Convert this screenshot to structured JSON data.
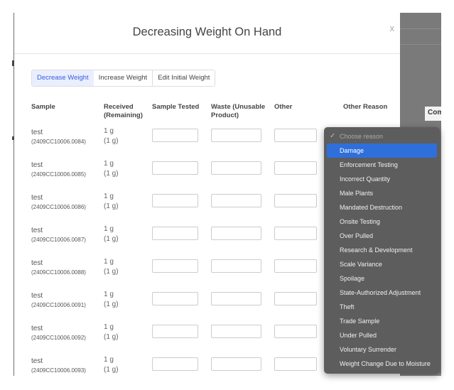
{
  "modal": {
    "title": "Decreasing Weight On Hand",
    "close_label": "x"
  },
  "tabs": [
    {
      "label": "Decrease Weight",
      "active": true
    },
    {
      "label": "Increase Weight",
      "active": false
    },
    {
      "label": "Edit Initial Weight",
      "active": false
    }
  ],
  "columns": {
    "sample": "Sample",
    "received": "Received (Remaining)",
    "sample_tested": "Sample Tested",
    "waste": "Waste (Unusable Product)",
    "other": "Other",
    "other_reason": "Other Reason"
  },
  "rows": [
    {
      "name": "test",
      "id": "(2409CC10006.0084)",
      "received": "1 g",
      "remaining": "(1 g)"
    },
    {
      "name": "test",
      "id": "(2409CC10006.0085)",
      "received": "1 g",
      "remaining": "(1 g)"
    },
    {
      "name": "test",
      "id": "(2409CC10006.0086)",
      "received": "1 g",
      "remaining": "(1 g)"
    },
    {
      "name": "test",
      "id": "(2409CC10006.0087)",
      "received": "1 g",
      "remaining": "(1 g)"
    },
    {
      "name": "test",
      "id": "(2409CC10006.0088)",
      "received": "1 g",
      "remaining": "(1 g)"
    },
    {
      "name": "test",
      "id": "(2409CC10006.0091)",
      "received": "1 g",
      "remaining": "(1 g)"
    },
    {
      "name": "test",
      "id": "(2409CC10006.0092)",
      "received": "1 g",
      "remaining": "(1 g)"
    },
    {
      "name": "test",
      "id": "(2409CC10006.0093)",
      "received": "1 g",
      "remaining": "(1 g)"
    }
  ],
  "dropdown": {
    "placeholder": "Choose reason",
    "selected": "Damage",
    "options": [
      "Damage",
      "Enforcement Testing",
      "Incorrect Quantity",
      "Male Plants",
      "Mandated Destruction",
      "Onsite Testing",
      "Over Pulled",
      "Research & Development",
      "Scale Variance",
      "Spoilage",
      "State-Authorized Adjustment",
      "Theft",
      "Trade Sample",
      "Under Pulled",
      "Voluntary Surrender",
      "Weight Change Due to Moisture"
    ]
  },
  "background": {
    "column_header_fragment": "Com"
  },
  "colors": {
    "accent": "#3b5bdb",
    "selected_option": "#2f6fdb",
    "dropdown_bg": "#5d5d5d",
    "overlay": "#6f6f6f"
  }
}
